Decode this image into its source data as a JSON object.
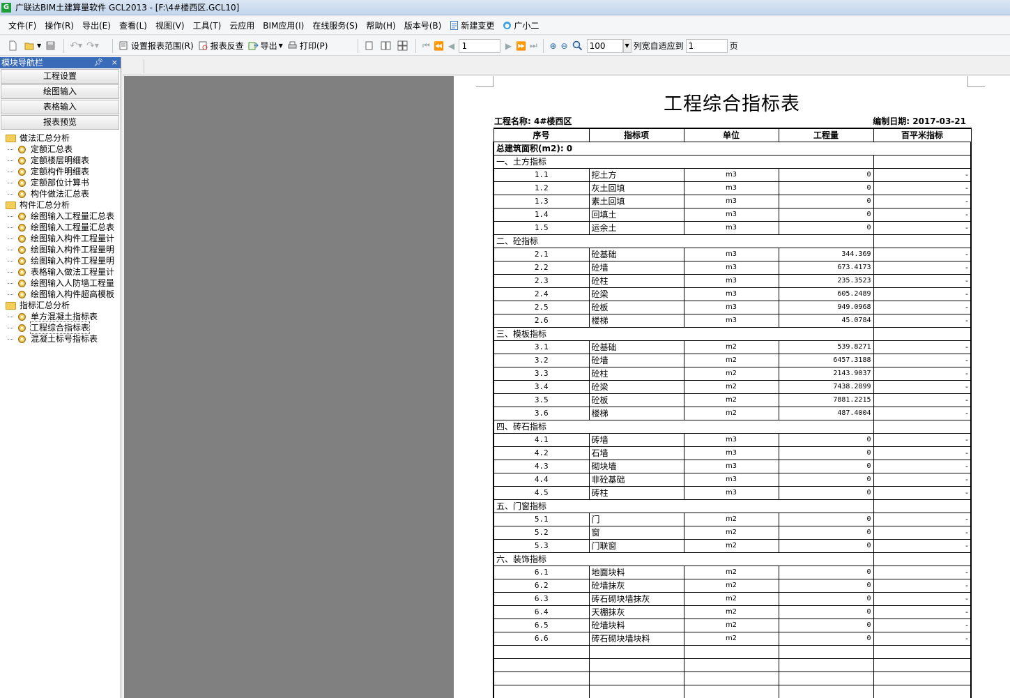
{
  "window": {
    "title": "广联达BIM土建算量软件 GCL2013 - [F:\\4#楼西区.GCL10]"
  },
  "menu": [
    "文件(F)",
    "操作(R)",
    "导出(E)",
    "查看(L)",
    "视图(V)",
    "工具(T)",
    "云应用",
    "BIM应用(I)",
    "在线服务(S)",
    "帮助(H)",
    "版本号(B)",
    "新建变更",
    "广小二"
  ],
  "toolbar": {
    "set_range": "设置报表范围(R)",
    "report_check": "报表反查",
    "export": "导出",
    "print": "打印(P)",
    "page_value": "1",
    "zoom_value": "100",
    "fit_width_label": "列宽自适应到",
    "fit_page_value": "1",
    "page_suffix": "页"
  },
  "sidebar": {
    "header": "模块导航栏",
    "pin": "ᵖ",
    "close": "×",
    "buttons": [
      "工程设置",
      "绘图输入",
      "表格输入",
      "报表预览"
    ],
    "tree": [
      {
        "folder": "做法汇总分析",
        "items": [
          "定额汇总表",
          "定额楼层明细表",
          "定额构件明细表",
          "定额部位计算书",
          "构件做法汇总表"
        ]
      },
      {
        "folder": "构件汇总分析",
        "items": [
          "绘图输入工程量汇总表",
          "绘图输入工程量汇总表",
          "绘图输入构件工程量计",
          "绘图输入构件工程量明",
          "绘图输入构件工程量明",
          "表格输入做法工程量计",
          "绘图输入人防墙工程量",
          "绘图输入构件超高模板"
        ]
      },
      {
        "folder": "指标汇总分析",
        "items": [
          "单方混凝土指标表",
          "工程综合指标表",
          "混凝土标号指标表"
        ]
      }
    ],
    "selected": "工程综合指标表"
  },
  "report": {
    "title": "工程综合指标表",
    "project_name": "工程名称: 4#楼西区",
    "edit_date": "编制日期: 2017-03-21",
    "headers": [
      "序号",
      "指标项",
      "单位",
      "工程量",
      "百平米指标"
    ],
    "total_area": "总建筑面积(m2): 0",
    "groups": [
      {
        "name": "一、土方指标",
        "rows": [
          [
            "1.1",
            "挖土方",
            "m3",
            "0",
            "-"
          ],
          [
            "1.2",
            "灰土回填",
            "m3",
            "0",
            "-"
          ],
          [
            "1.3",
            "素土回填",
            "m3",
            "0",
            "-"
          ],
          [
            "1.4",
            "回填土",
            "m3",
            "0",
            "-"
          ],
          [
            "1.5",
            "运余土",
            "m3",
            "0",
            "-"
          ]
        ]
      },
      {
        "name": "二、砼指标",
        "rows": [
          [
            "2.1",
            "砼基础",
            "m3",
            "344.369",
            "-"
          ],
          [
            "2.2",
            "砼墙",
            "m3",
            "673.4173",
            "-"
          ],
          [
            "2.3",
            "砼柱",
            "m3",
            "235.3523",
            "-"
          ],
          [
            "2.4",
            "砼梁",
            "m3",
            "605.2489",
            "-"
          ],
          [
            "2.5",
            "砼板",
            "m3",
            "949.0968",
            "-"
          ],
          [
            "2.6",
            "楼梯",
            "m3",
            "45.0784",
            "-"
          ]
        ]
      },
      {
        "name": "三、模板指标",
        "rows": [
          [
            "3.1",
            "砼基础",
            "m2",
            "539.8271",
            "-"
          ],
          [
            "3.2",
            "砼墙",
            "m2",
            "6457.3188",
            "-"
          ],
          [
            "3.3",
            "砼柱",
            "m2",
            "2143.9037",
            "-"
          ],
          [
            "3.4",
            "砼梁",
            "m2",
            "7438.2899",
            "-"
          ],
          [
            "3.5",
            "砼板",
            "m2",
            "7881.2215",
            "-"
          ],
          [
            "3.6",
            "楼梯",
            "m2",
            "487.4004",
            "-"
          ]
        ]
      },
      {
        "name": "四、砖石指标",
        "rows": [
          [
            "4.1",
            "砖墙",
            "m3",
            "0",
            "-"
          ],
          [
            "4.2",
            "石墙",
            "m3",
            "0",
            "-"
          ],
          [
            "4.3",
            "砌块墙",
            "m3",
            "0",
            "-"
          ],
          [
            "4.4",
            "非砼基础",
            "m3",
            "0",
            "-"
          ],
          [
            "4.5",
            "砖柱",
            "m3",
            "0",
            "-"
          ]
        ]
      },
      {
        "name": "五、门窗指标",
        "rows": [
          [
            "5.1",
            "门",
            "m2",
            "0",
            "-"
          ],
          [
            "5.2",
            "窗",
            "m2",
            "0",
            "-"
          ],
          [
            "5.3",
            "门联窗",
            "m2",
            "0",
            "-"
          ]
        ]
      },
      {
        "name": "六、装饰指标",
        "rows": [
          [
            "6.1",
            "地面块料",
            "m2",
            "0",
            "-"
          ],
          [
            "6.2",
            "砼墙抹灰",
            "m2",
            "0",
            "-"
          ],
          [
            "6.3",
            "砖石砌块墙抹灰",
            "m2",
            "0",
            "-"
          ],
          [
            "6.4",
            "天棚抹灰",
            "m2",
            "0",
            "-"
          ],
          [
            "6.5",
            "砼墙块料",
            "m2",
            "0",
            "-"
          ],
          [
            "6.6",
            "砖石砌块墙块料",
            "m2",
            "0",
            "-"
          ]
        ]
      }
    ],
    "empty_rows": 4
  },
  "colors": {
    "sidebar_header": "#3a6bb8",
    "preview_bg": "#808080"
  }
}
